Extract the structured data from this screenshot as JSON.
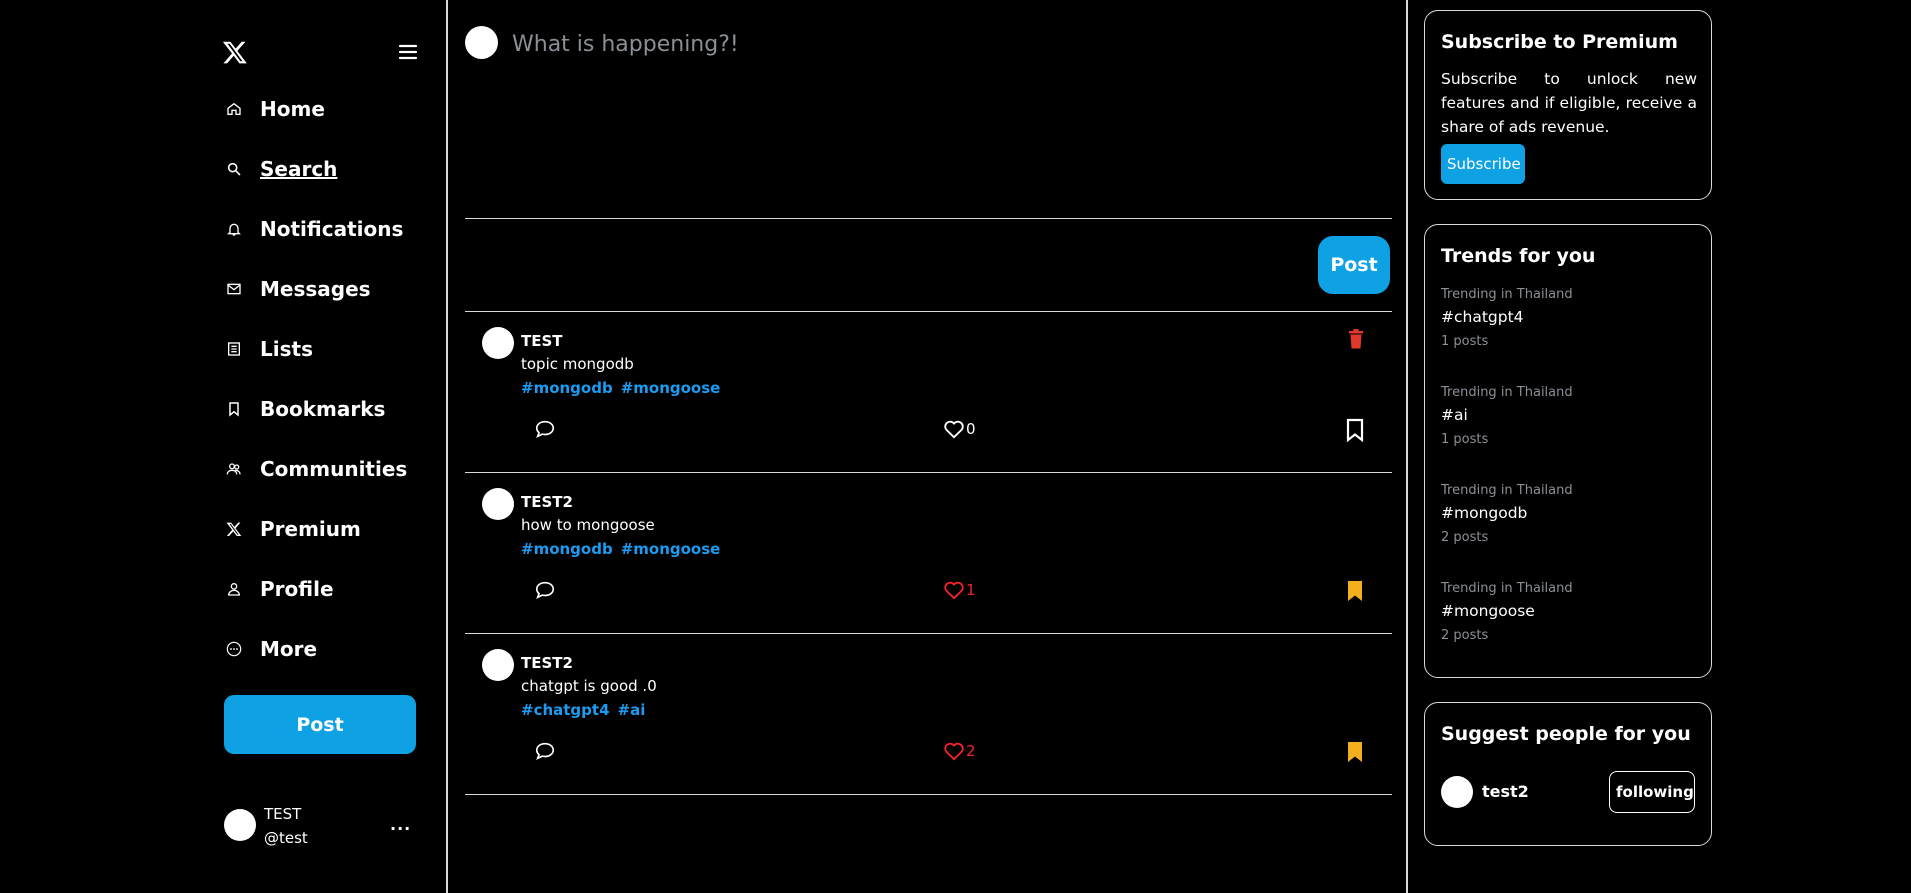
{
  "nav": {
    "items": [
      {
        "label": "Home",
        "icon": "home-icon"
      },
      {
        "label": "Search",
        "icon": "search-icon"
      },
      {
        "label": "Notifications",
        "icon": "bell-icon"
      },
      {
        "label": "Messages",
        "icon": "envelope-icon"
      },
      {
        "label": "Lists",
        "icon": "list-icon"
      },
      {
        "label": "Bookmarks",
        "icon": "bookmark-icon"
      },
      {
        "label": "Communities",
        "icon": "communities-icon"
      },
      {
        "label": "Premium",
        "icon": "x-logo-icon"
      },
      {
        "label": "Profile",
        "icon": "person-icon"
      },
      {
        "label": "More",
        "icon": "more-circle-icon"
      }
    ],
    "active": "Search",
    "post_label": "Post"
  },
  "user": {
    "name": "TEST",
    "handle": "@test",
    "more": "..."
  },
  "compose": {
    "placeholder": "What is happening?!",
    "post_label": "Post"
  },
  "posts": [
    {
      "author": "TEST",
      "text": "topic mongodb",
      "tags": [
        "#mongodb",
        "#mongoose"
      ],
      "likes": "0",
      "liked": false,
      "bookmarked": false,
      "deletable": true
    },
    {
      "author": "TEST2",
      "text": "how to mongoose",
      "tags": [
        "#mongodb",
        "#mongoose"
      ],
      "likes": "1",
      "liked": true,
      "bookmarked": true,
      "deletable": false
    },
    {
      "author": "TEST2",
      "text": "chatgpt is good .0",
      "tags": [
        "#chatgpt4",
        "#ai"
      ],
      "likes": "2",
      "liked": true,
      "bookmarked": true,
      "deletable": false
    }
  ],
  "premium": {
    "title": "Subscribe to Premium",
    "text": "Subscribe to unlock new features and if eligible, receive a share of ads revenue.",
    "button": "Subscribe"
  },
  "trends": {
    "title": "Trends for you",
    "items": [
      {
        "location": "Trending in Thailand",
        "tag": "#chatgpt4",
        "count": "1 posts"
      },
      {
        "location": "Trending in Thailand",
        "tag": "#ai",
        "count": "1 posts"
      },
      {
        "location": "Trending in Thailand",
        "tag": "#mongodb",
        "count": "2 posts"
      },
      {
        "location": "Trending in Thailand",
        "tag": "#mongoose",
        "count": "2 posts"
      }
    ]
  },
  "suggest": {
    "title": "Suggest people for you",
    "people": [
      {
        "name": "test2",
        "button": "following"
      }
    ]
  },
  "colors": {
    "accent": "#0ea1e3",
    "link": "#1d9bf0",
    "like": "#f4212e",
    "bookmark": "#f2b01e",
    "delete": "#e0392b"
  }
}
